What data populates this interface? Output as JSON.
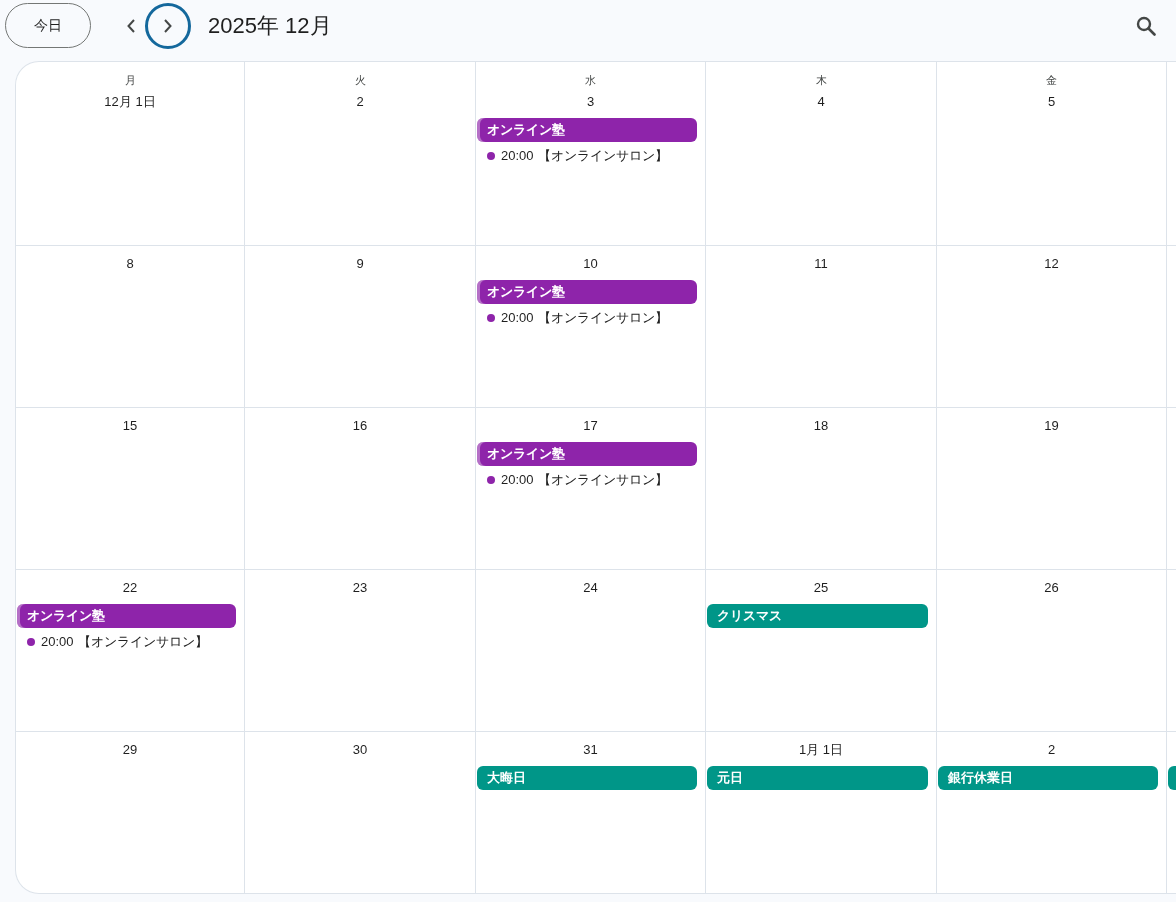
{
  "toolbar": {
    "today_button": "今日",
    "prev_button": {
      "focused": false
    },
    "next_button": {
      "focused": true
    },
    "title": "2025年 12月"
  },
  "weekdays": [
    "月",
    "火",
    "水",
    "木",
    "金"
  ],
  "weeks": [
    {
      "days": [
        {
          "date": "12月 1日"
        },
        {
          "date": "2"
        },
        {
          "date": "3",
          "events": [
            {
              "kind": "all_day",
              "title": "オンライン塾",
              "color": "#8e24aa",
              "left_stripe": true
            },
            {
              "kind": "timed",
              "time": "20:00",
              "title": "【オンラインサロン】",
              "color": "#8e24aa"
            }
          ]
        },
        {
          "date": "4"
        },
        {
          "date": "5"
        }
      ]
    },
    {
      "days": [
        {
          "date": "8"
        },
        {
          "date": "9"
        },
        {
          "date": "10",
          "events": [
            {
              "kind": "all_day",
              "title": "オンライン塾",
              "color": "#8e24aa",
              "left_stripe": true
            },
            {
              "kind": "timed",
              "time": "20:00",
              "title": "【オンラインサロン】",
              "color": "#8e24aa"
            }
          ]
        },
        {
          "date": "11"
        },
        {
          "date": "12"
        }
      ]
    },
    {
      "days": [
        {
          "date": "15"
        },
        {
          "date": "16"
        },
        {
          "date": "17",
          "events": [
            {
              "kind": "all_day",
              "title": "オンライン塾",
              "color": "#8e24aa",
              "left_stripe": true
            },
            {
              "kind": "timed",
              "time": "20:00",
              "title": "【オンラインサロン】",
              "color": "#8e24aa"
            }
          ]
        },
        {
          "date": "18"
        },
        {
          "date": "19"
        }
      ]
    },
    {
      "days": [
        {
          "date": "22",
          "events": [
            {
              "kind": "all_day",
              "title": "オンライン塾",
              "color": "#8e24aa",
              "left_stripe": true
            },
            {
              "kind": "timed",
              "time": "20:00",
              "title": "【オンラインサロン】",
              "color": "#8e24aa"
            }
          ]
        },
        {
          "date": "23"
        },
        {
          "date": "24"
        },
        {
          "date": "25",
          "events": [
            {
              "kind": "all_day",
              "title": "クリスマス",
              "color": "#009688",
              "left_stripe": false
            }
          ]
        },
        {
          "date": "26"
        }
      ]
    },
    {
      "days": [
        {
          "date": "29"
        },
        {
          "date": "30"
        },
        {
          "date": "31",
          "events": [
            {
              "kind": "all_day",
              "title": "大晦日",
              "color": "#009688",
              "left_stripe": false
            }
          ]
        },
        {
          "date": "1月 1日",
          "events": [
            {
              "kind": "all_day",
              "title": "元日",
              "color": "#009688",
              "left_stripe": false
            }
          ]
        },
        {
          "date": "2",
          "events": [
            {
              "kind": "all_day",
              "title": "銀行休業日",
              "color": "#009688",
              "left_stripe": false
            }
          ]
        },
        {
          "events": [
            {
              "kind": "all_day",
              "color": "#009688",
              "left_stripe": false
            }
          ]
        }
      ]
    }
  ]
}
